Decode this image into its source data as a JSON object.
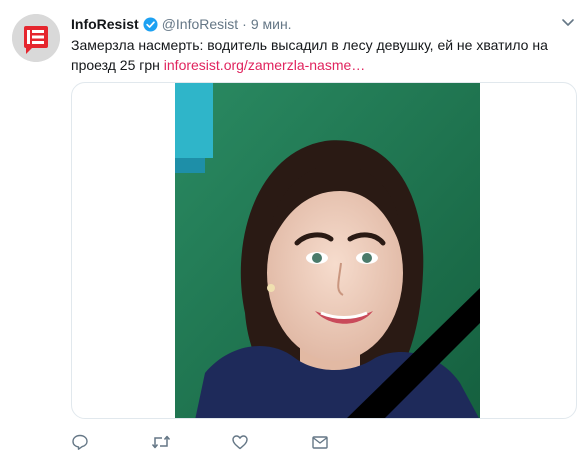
{
  "tweet": {
    "author_name": "InfoResist",
    "author_handle": "@InfoResist",
    "separator": "·",
    "timestamp": "9 мин.",
    "text": "Замерзла насмерть: водитель высадил в лесу девушку, ей не хватило на проезд 25 грн ",
    "link_text": "inforesist.org/zamerzla-nasme…"
  },
  "icons": {
    "avatar": "inforesist-logo",
    "verified": "verified-badge-icon",
    "menu": "chevron-down-icon",
    "reply": "reply-icon",
    "retweet": "retweet-icon",
    "like": "heart-icon",
    "dm": "envelope-icon"
  },
  "colors": {
    "link": "#e0245e",
    "verified": "#1da1f2",
    "action_icon": "#657786",
    "logo_red": "#e5262e"
  }
}
